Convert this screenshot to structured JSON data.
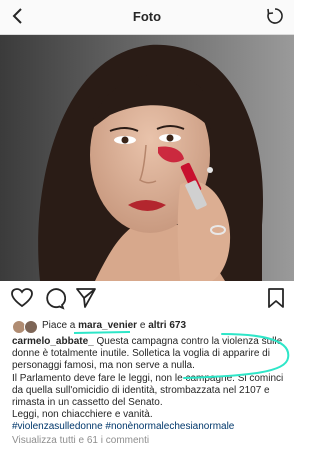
{
  "header": {
    "title": "Foto"
  },
  "icons": {
    "back": "chevron-left-icon",
    "refresh": "refresh-icon",
    "like": "heart-icon",
    "comment": "comment-icon",
    "share": "paper-plane-icon",
    "save": "bookmark-icon"
  },
  "likes": {
    "prefix": "Piace a",
    "user": "mara_venier",
    "middle": "e",
    "others": "altri 673"
  },
  "caption": {
    "author": "carmelo_abbate_",
    "line1": "Questa campagna contro la violenza sulle donne è totalmente inutile. Solletica la voglia di apparire di personaggi famosi, ma non serve a nulla.",
    "line2": "Il Parlamento deve fare le leggi, non le campagne. Si cominci da quella sull'omicidio di identità, strombazzata nel 2107 e rimasta in un cassetto del Senato.",
    "line3": "Leggi, non chiacchiere e vanità.",
    "hashtags": "#violenzasulledonne #nonènormalechesianormale"
  },
  "comments": {
    "view_all": "Visualizza tutti e 61 i commenti"
  },
  "colors": {
    "annotation": "#2ee6c8",
    "link": "#00376b",
    "muted": "#8e8e8e",
    "lipstick": "#c8102e"
  }
}
